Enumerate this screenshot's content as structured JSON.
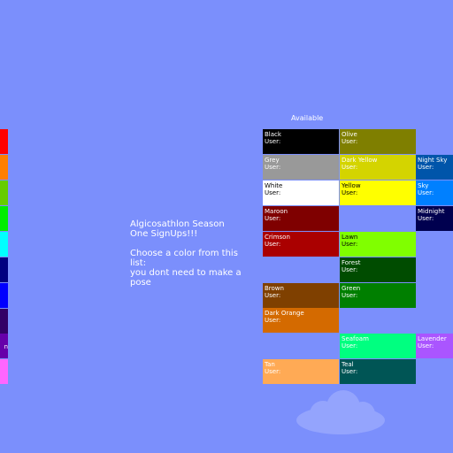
{
  "intro_text": "Algicosathlon Season One SignUps!!!\n\nChoose a color from this list:\nyou dont need to make a pose",
  "available_label": "Available",
  "user_label": "User:",
  "left_edge_label": "n",
  "left_swatches": [
    "#ff0000",
    "#ff7f00",
    "#66cc00",
    "#00ee00",
    "#00ffff",
    "#000080",
    "#0000ff",
    "#330066",
    "#6600aa",
    "#ff66ff"
  ],
  "tiles": [
    {
      "name": "Black",
      "color": "#000000",
      "text": "#ffffff"
    },
    {
      "name": "Olive",
      "color": "#7f7f00",
      "text": "#ffffff"
    },
    {
      "name": "Night Sky",
      "color": "#0055aa",
      "text": "#ffffff"
    },
    {
      "name": "Grey",
      "color": "#999999",
      "text": "#ffffff"
    },
    {
      "name": "Dark Yellow",
      "color": "#d4d400",
      "text": "#ffffff"
    },
    {
      "name": "Sky",
      "color": "#0080ff",
      "text": "#ffffff"
    },
    {
      "name": "White",
      "color": "#ffffff",
      "text": "#000000"
    },
    {
      "name": "Yellow",
      "color": "#ffff00",
      "text": "#000000"
    },
    {
      "name": "Maroon",
      "color": "#7f0000",
      "text": "#ffffff"
    },
    {
      "name": "Midnight",
      "color": "#00004f",
      "text": "#ffffff"
    },
    {
      "name": "Crimson",
      "color": "#aa0000",
      "text": "#ffffff"
    },
    {
      "name": "Lawn",
      "color": "#80ff00",
      "text": "#000000"
    },
    {
      "name": "Forest",
      "color": "#004c00",
      "text": "#ffffff"
    },
    {
      "name": "Brown",
      "color": "#7f4000",
      "text": "#ffffff"
    },
    {
      "name": "Green",
      "color": "#007f00",
      "text": "#ffffff"
    },
    {
      "name": "Dark Orange",
      "color": "#d46a00",
      "text": "#ffffff"
    },
    {
      "name": "Seafoam",
      "color": "#00ff80",
      "text": "#ffffff"
    },
    {
      "name": "Lavender",
      "color": "#aa55ff",
      "text": "#ffffff"
    },
    {
      "name": "Tan",
      "color": "#ffaa55",
      "text": "#ffffff"
    },
    {
      "name": "Teal",
      "color": "#005555",
      "text": "#ffffff"
    }
  ]
}
